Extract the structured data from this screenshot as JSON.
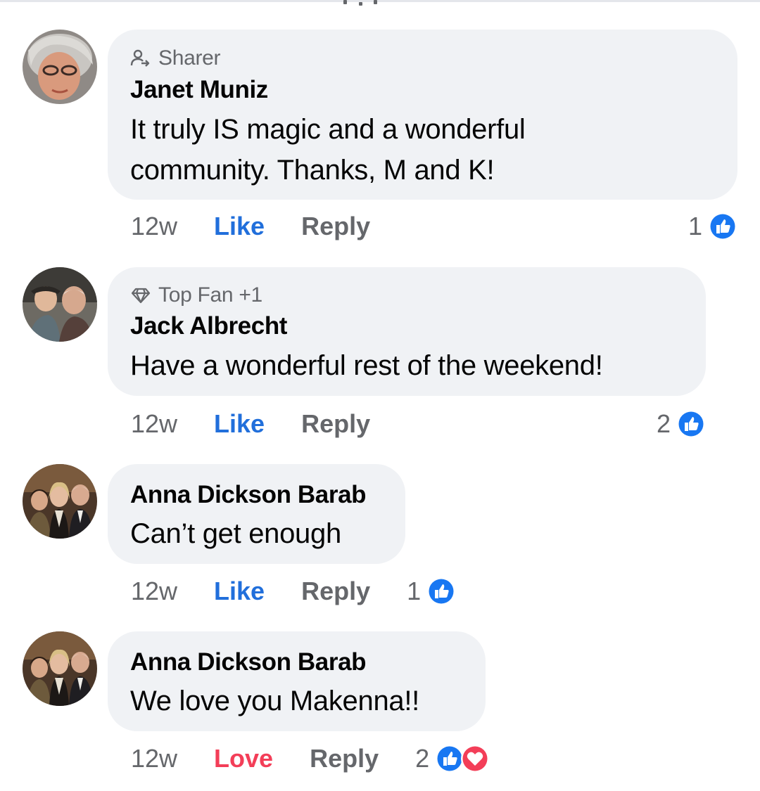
{
  "colors": {
    "bubble": "#f0f2f5",
    "like_blue": "#216fdb",
    "love_red": "#f33e58",
    "secondary_text": "#65676b",
    "primary_text": "#050505"
  },
  "comments": [
    {
      "badge": "Sharer",
      "badge_icon": "sharer-icon",
      "author": "Janet Muniz",
      "text_lines": [
        "It truly IS magic and a wonderful",
        "community. Thanks, M and K!"
      ],
      "time": "12w",
      "action_label": "Like",
      "reply_label": "Reply",
      "reaction_count": "1",
      "reactions": [
        "like-reaction-icon"
      ]
    },
    {
      "badge": "Top Fan +1",
      "badge_icon": "diamond-icon",
      "author": "Jack Albrecht",
      "text_lines": [
        "Have a wonderful rest of the weekend!"
      ],
      "time": "12w",
      "action_label": "Like",
      "reply_label": "Reply",
      "reaction_count": "2",
      "reactions": [
        "like-reaction-icon"
      ]
    },
    {
      "author": "Anna Dickson Barab",
      "text_lines": [
        "Can’t get enough"
      ],
      "time": "12w",
      "action_label": "Like",
      "reply_label": "Reply",
      "reaction_count": "1",
      "reactions": [
        "like-reaction-icon"
      ]
    },
    {
      "author": "Anna Dickson Barab",
      "text_lines": [
        "We love you Makenna!!"
      ],
      "time": "12w",
      "action_label": "Love",
      "reply_label": "Reply",
      "reaction_count": "2",
      "reactions": [
        "like-reaction-icon",
        "love-reaction-icon"
      ]
    }
  ]
}
